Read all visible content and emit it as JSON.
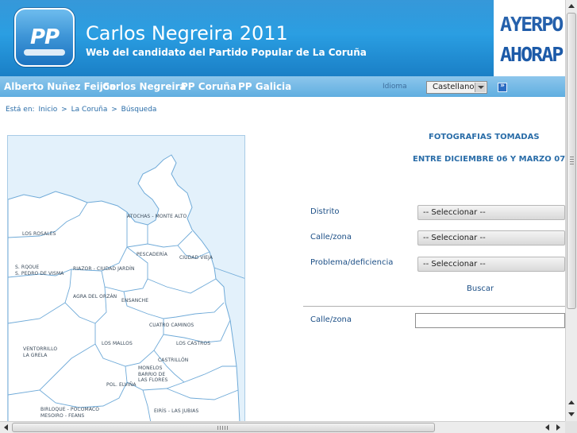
{
  "header": {
    "logo_text": "PP",
    "title": "Carlos Negreira 2011",
    "subtitle": "Web del candidato del Partido Popular de La Coruña",
    "banner_top": "AYERPO",
    "banner_bottom": "AHORAP"
  },
  "nav": {
    "items": [
      "Alberto Nuñez Feijoo",
      "Carlos Negreira",
      "PP Coruña",
      "PP Galicia"
    ],
    "idioma_label": "Idioma",
    "language_value": "Castellano",
    "go_label": "»"
  },
  "breadcrumb": {
    "prefix": "Está en:",
    "items": [
      "Inicio",
      "La Coruña",
      "Búsqueda"
    ],
    "separator": ">"
  },
  "map": {
    "districts": [
      "ATOCHAS - MONTE ALTO",
      "LOS ROSALES",
      "PESCADERÍA",
      "CIUDAD VIEJA",
      "S. RQOUE",
      "S. PEDRO DE VISMA",
      "RIAZOR - CIUDAD JARDÍN",
      "AGRA DEL ORZÁN",
      "ENSANCHE",
      "CUATRO CAMINOS",
      "LOS MALLOS",
      "LOS CASTROS",
      "VENTORRILLO",
      "LA GRELA",
      "CASTRILLÓN",
      "MONELOS",
      "BARRIO DE",
      "LAS FLORES",
      "POL. ELVIÑA",
      "BIRLOQUE - POCOMACO",
      "MESOIRO - FEANS",
      "EIRÍS - LAS JUBIAS"
    ]
  },
  "photos": {
    "title": "FOTOGRAFIAS TOMADAS",
    "subtitle": "ENTRE DICIEMBRE 06 Y MARZO 07"
  },
  "form": {
    "distrito_label": "Distrito",
    "calle_label": "Calle/zona",
    "problema_label": "Problema/deficiencia",
    "select_placeholder": "-- Seleccionar --",
    "search_label": "Buscar",
    "calle2_label": "Calle/zona",
    "calle2_value": ""
  },
  "colors": {
    "brand_blue": "#1a8ad4",
    "nav_blue": "#6fb8e6",
    "link_blue": "#2a6da8",
    "map_water": "#e3f1fb"
  }
}
